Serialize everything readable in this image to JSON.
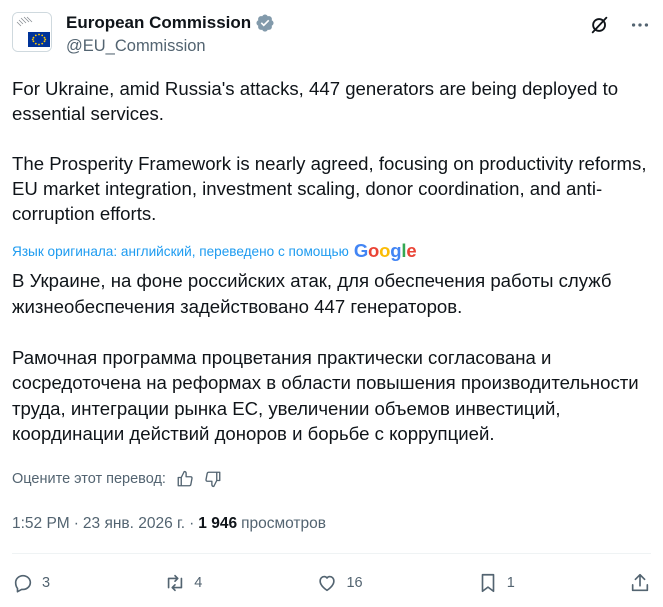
{
  "header": {
    "account_name": "European Commission",
    "handle": "@EU_Commission"
  },
  "tweet": {
    "para1": "For Ukraine, amid Russia's attacks, 447 generators are being deployed to essential services.",
    "para2": "The Prosperity Framework is nearly agreed, focusing on productivity reforms, EU market integration, investment scaling, donor coordination, and anti-corruption efforts."
  },
  "translation": {
    "notice": "Язык оригинала: английский, переведено с помощью",
    "provider_letters": [
      "G",
      "o",
      "o",
      "g",
      "l",
      "e"
    ],
    "para1": "В Украине, на фоне российских атак, для обеспечения работы служб жизнеобеспечения задействовано 447 генераторов.",
    "para2": "Рамочная программа процветания практически согласована и сосредоточена на реформах в области повышения производительности труда, интеграции рынка ЕС, увеличении объемов инвестиций, координации действий доноров и борьбе с коррупцией.",
    "rate_label": "Оцените этот перевод:"
  },
  "meta": {
    "time": "1:52 PM",
    "date": "23 янв. 2026 г.",
    "views_count": "1 946",
    "views_label": "просмотров"
  },
  "actions": {
    "replies": "3",
    "reposts": "4",
    "likes": "16",
    "bookmarks": "1"
  },
  "colors": {
    "accent": "#1d9bf0",
    "text": "#0f1419",
    "muted": "#536471",
    "eu_blue": "#003399",
    "eu_star": "#ffcc00"
  }
}
